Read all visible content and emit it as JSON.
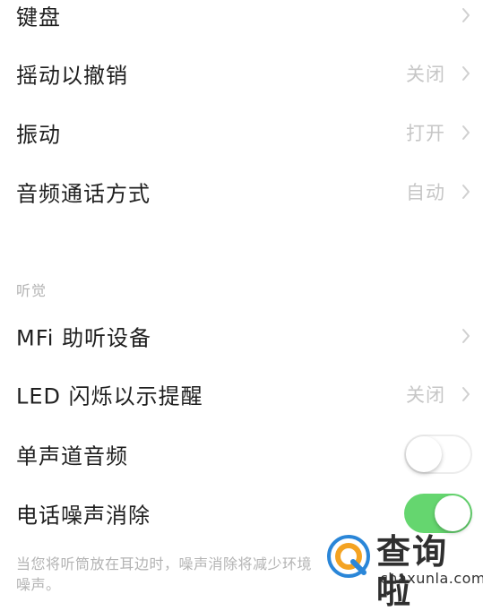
{
  "settings": {
    "rows": [
      {
        "label": "键盘",
        "value": ""
      },
      {
        "label": "摇动以撤销",
        "value": "关闭"
      },
      {
        "label": "振动",
        "value": "打开"
      },
      {
        "label": "音频通话方式",
        "value": "自动"
      }
    ],
    "hearing_section": {
      "header": "听觉",
      "rows": [
        {
          "label": "MFi 助听设备",
          "value": ""
        },
        {
          "label": "LED 闪烁以示提醒",
          "value": "关闭"
        }
      ],
      "toggles": [
        {
          "label": "单声道音频",
          "state": "off"
        },
        {
          "label": "电话噪声消除",
          "state": "on"
        }
      ],
      "footer": "当您将听筒放在耳边时，噪声消除将减少环境噪声。"
    }
  },
  "watermark": {
    "main": "查询啦",
    "sub": "chaxunla.com"
  },
  "colors": {
    "toggle_on": "#65d66f",
    "secondary_text": "#c6c6c6",
    "chevron": "#d0d0d0"
  },
  "icons": {
    "chevron": "chevron-right-icon",
    "logo": "q-search-logo"
  }
}
